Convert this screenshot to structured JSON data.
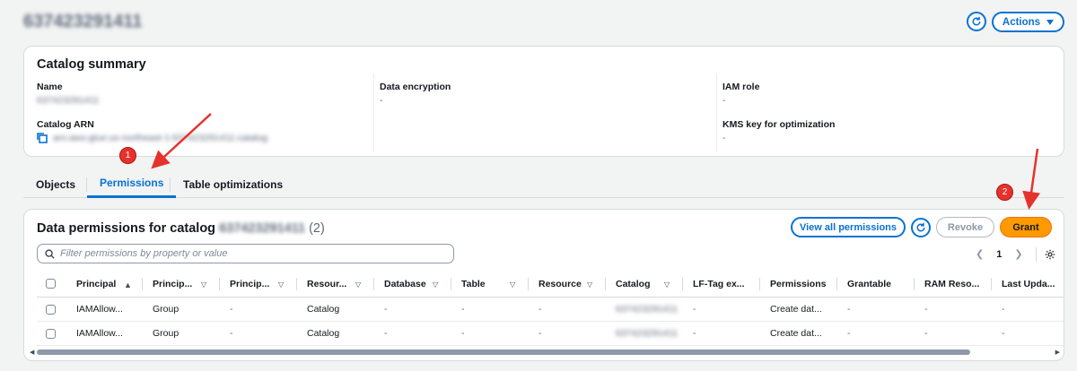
{
  "page": {
    "title": "637423291411",
    "actions_label": "Actions"
  },
  "summary": {
    "title": "Catalog summary",
    "fields": {
      "name_label": "Name",
      "name_value": "637423291411",
      "arn_label": "Catalog ARN",
      "arn_value": "arn:aws:glue:us-northeast-1:637423291411:catalog",
      "encryption_label": "Data encryption",
      "encryption_value": "-",
      "iam_label": "IAM role",
      "iam_value": "-",
      "kms_label": "KMS key for optimization",
      "kms_value": "-"
    }
  },
  "tabs": [
    {
      "label": "Objects",
      "active": false
    },
    {
      "label": "Permissions",
      "active": true
    },
    {
      "label": "Table optimizations",
      "active": false
    }
  ],
  "annotations": {
    "step1": "1",
    "step2": "2",
    "color": "#e5322d"
  },
  "permissions": {
    "title": "Data permissions for catalog",
    "catalog_id": "637423291411",
    "count": "(2)",
    "view_all_label": "View all permissions",
    "revoke_label": "Revoke",
    "grant_label": "Grant",
    "filter_placeholder": "Filter permissions by property or value",
    "page": "1",
    "columns": [
      "Principal",
      "Princip...",
      "Princip...",
      "Resour...",
      "Database",
      "Table",
      "Resource",
      "Catalog",
      "LF-Tag ex...",
      "Permissions",
      "Grantable",
      "RAM Reso...",
      "Last Upda..."
    ],
    "rows": [
      [
        "IAMAllow...",
        "Group",
        "-",
        "Catalog",
        "-",
        "-",
        "-",
        "637423291411",
        "-",
        "Create dat...",
        "-",
        "-",
        "-"
      ],
      [
        "IAMAllow...",
        "Group",
        "-",
        "Catalog",
        "-",
        "-",
        "-",
        "637423291411",
        "-",
        "Create dat...",
        "-",
        "-",
        "-"
      ]
    ]
  },
  "colors": {
    "primary": "#0972d3",
    "grant": "#ff9900",
    "text": "#16191f"
  }
}
